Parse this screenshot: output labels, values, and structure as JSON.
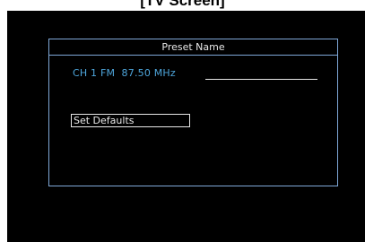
{
  "caption": "[TV Screen]",
  "dialog": {
    "title": "Preset Name",
    "station": {
      "channel": "CH 1",
      "band": "FM",
      "frequency": "87.50 MHz",
      "text": "CH 1 FM  87.50 MHz"
    },
    "preset_name_value": "",
    "set_defaults_label": "Set Defaults"
  },
  "colors": {
    "screen_background": "#000000",
    "border": "#7fa8d8",
    "station_text": "#4ea6dc",
    "text": "#e8e8e8"
  }
}
